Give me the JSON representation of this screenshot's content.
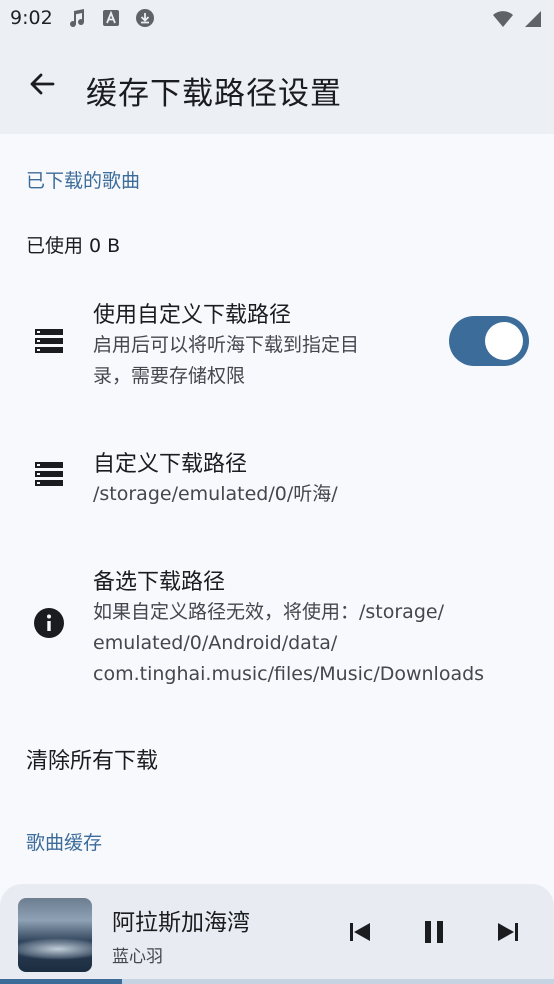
{
  "status_bar": {
    "time": "9:02",
    "icons": [
      "music-note-icon",
      "font-icon",
      "download-icon",
      "wifi-icon",
      "signal-icon"
    ]
  },
  "app_bar": {
    "title": "缓存下载路径设置",
    "back_icon": "back-arrow-icon"
  },
  "downloaded_section": {
    "header": "已下载的歌曲",
    "usage_text": "已使用 0 B"
  },
  "custom_path_toggle": {
    "icon": "storage-icon",
    "title": "使用自定义下载路径",
    "subtitle_line1": "启用后可以将听海下载到指定目",
    "subtitle_line2": "录，需要存储权限",
    "enabled": true
  },
  "custom_path": {
    "icon": "storage-icon",
    "title": "自定义下载路径",
    "value": "/storage/emulated/0/听海/"
  },
  "fallback_path": {
    "icon": "info-icon",
    "title": "备选下载路径",
    "line1": "如果自定义路径无效，将使用：/storage/",
    "line2": "emulated/0/Android/data/",
    "line3": "com.tinghai.music/files/Music/Downloads"
  },
  "clear_all": {
    "label": "清除所有下载"
  },
  "cache_section": {
    "header": "歌曲缓存"
  },
  "mini_player": {
    "song_title": "阿拉斯加海湾",
    "artist": "蓝心羽",
    "progress": 0.22,
    "colors": {
      "accent": "#3c6c9a",
      "track": "#c6d3e2"
    }
  }
}
